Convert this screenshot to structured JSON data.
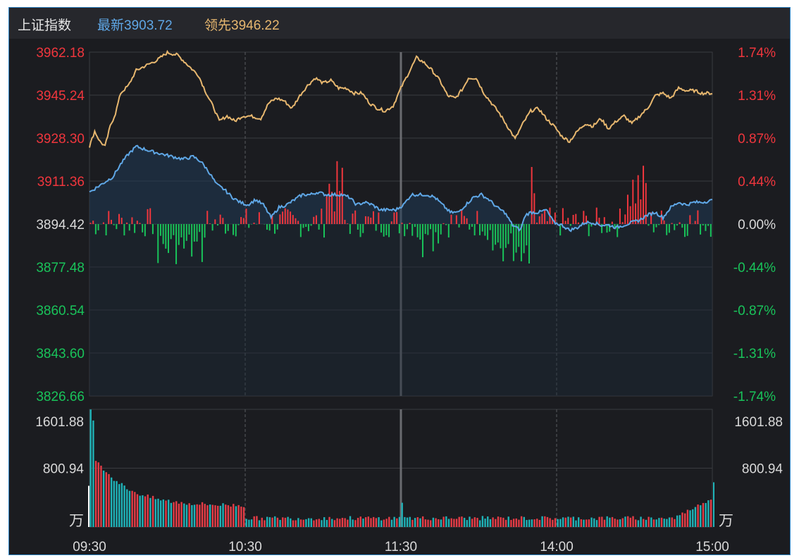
{
  "header": {
    "title": "上证指数",
    "latest_label": "最新3903.72",
    "leading_label": "领先3946.22"
  },
  "colors": {
    "up": "#f0363d",
    "down": "#19c35a",
    "neutral_text": "#d9d9d9",
    "index_line": "#e7b76f",
    "leading_line": "#5fa7e6",
    "volume_up": "#e63c46",
    "volume_down": "#1fb3b8",
    "grid": "#3a3b40"
  },
  "chart_data": {
    "type": "line",
    "title": "上证指数",
    "price_axis": {
      "labels": [
        "3962.18",
        "3945.24",
        "3928.30",
        "3911.36",
        "3894.42",
        "3877.48",
        "3860.54",
        "3843.60",
        "3826.66"
      ],
      "ylim": [
        3826.66,
        3962.18
      ],
      "base": 3894.42
    },
    "percent_axis": {
      "labels": [
        "1.74%",
        "1.31%",
        "0.87%",
        "0.44%",
        "0.00%",
        "-0.44%",
        "-0.87%",
        "-1.31%",
        "-1.74%"
      ]
    },
    "volume_axis": {
      "labels": [
        "1601.88",
        "800.94"
      ],
      "unit": "万",
      "ylim": [
        0,
        1601.88
      ]
    },
    "x_labels": [
      "09:30",
      "10:30",
      "11:30",
      "14:00",
      "15:00"
    ],
    "minutes_total": 240,
    "series": [
      {
        "name": "最新",
        "color": "#e7b76f",
        "points": [
          [
            0,
            3925
          ],
          [
            2,
            3931
          ],
          [
            4,
            3927
          ],
          [
            6,
            3925
          ],
          [
            8,
            3933
          ],
          [
            10,
            3938
          ],
          [
            12,
            3946
          ],
          [
            15,
            3949
          ],
          [
            18,
            3955
          ],
          [
            22,
            3957
          ],
          [
            26,
            3959
          ],
          [
            30,
            3962
          ],
          [
            34,
            3961
          ],
          [
            38,
            3957
          ],
          [
            42,
            3953
          ],
          [
            45,
            3946
          ],
          [
            48,
            3940
          ],
          [
            50,
            3935
          ],
          [
            53,
            3937
          ],
          [
            56,
            3935
          ],
          [
            59,
            3937
          ],
          [
            62,
            3937
          ],
          [
            66,
            3936
          ],
          [
            69,
            3942
          ],
          [
            72,
            3944
          ],
          [
            75,
            3943
          ],
          [
            78,
            3940
          ],
          [
            81,
            3945
          ],
          [
            84,
            3949
          ],
          [
            87,
            3952
          ],
          [
            90,
            3950
          ],
          [
            93,
            3951
          ],
          [
            96,
            3948
          ],
          [
            99,
            3948
          ],
          [
            102,
            3946
          ],
          [
            105,
            3946
          ],
          [
            108,
            3942
          ],
          [
            111,
            3940
          ],
          [
            114,
            3939
          ],
          [
            117,
            3941
          ],
          [
            120,
            3948
          ],
          [
            123,
            3954
          ],
          [
            126,
            3960
          ],
          [
            129,
            3958
          ],
          [
            132,
            3955
          ],
          [
            135,
            3951
          ],
          [
            138,
            3945
          ],
          [
            141,
            3944
          ],
          [
            144,
            3948
          ],
          [
            146,
            3952
          ],
          [
            149,
            3952
          ],
          [
            152,
            3946
          ],
          [
            155,
            3942
          ],
          [
            158,
            3938
          ],
          [
            161,
            3933
          ],
          [
            164,
            3928
          ],
          [
            167,
            3934
          ],
          [
            170,
            3939
          ],
          [
            173,
            3940
          ],
          [
            176,
            3936
          ],
          [
            179,
            3933
          ],
          [
            182,
            3929
          ],
          [
            185,
            3927
          ],
          [
            188,
            3931
          ],
          [
            191,
            3934
          ],
          [
            194,
            3933
          ],
          [
            197,
            3936
          ],
          [
            200,
            3932
          ],
          [
            203,
            3935
          ],
          [
            206,
            3937
          ],
          [
            209,
            3934
          ],
          [
            212,
            3937
          ],
          [
            215,
            3940
          ],
          [
            218,
            3945
          ],
          [
            221,
            3946
          ],
          [
            224,
            3944
          ],
          [
            227,
            3948
          ],
          [
            230,
            3947
          ],
          [
            233,
            3947
          ],
          [
            236,
            3946
          ],
          [
            240,
            3946
          ]
        ]
      },
      {
        "name": "领先",
        "color": "#5fa7e6",
        "points": [
          [
            0,
            3907
          ],
          [
            3,
            3909
          ],
          [
            6,
            3911
          ],
          [
            9,
            3913
          ],
          [
            12,
            3918
          ],
          [
            15,
            3922
          ],
          [
            18,
            3925
          ],
          [
            21,
            3924
          ],
          [
            24,
            3923
          ],
          [
            28,
            3922
          ],
          [
            32,
            3921
          ],
          [
            36,
            3920
          ],
          [
            40,
            3921
          ],
          [
            43,
            3919
          ],
          [
            46,
            3915
          ],
          [
            49,
            3910
          ],
          [
            52,
            3908
          ],
          [
            55,
            3905
          ],
          [
            58,
            3903
          ],
          [
            61,
            3902
          ],
          [
            64,
            3904
          ],
          [
            67,
            3902
          ],
          [
            70,
            3897
          ],
          [
            73,
            3901
          ],
          [
            76,
            3902
          ],
          [
            79,
            3904
          ],
          [
            82,
            3906
          ],
          [
            85,
            3906
          ],
          [
            88,
            3907
          ],
          [
            91,
            3906
          ],
          [
            94,
            3906
          ],
          [
            97,
            3906
          ],
          [
            100,
            3905
          ],
          [
            103,
            3902
          ],
          [
            106,
            3903
          ],
          [
            109,
            3902
          ],
          [
            112,
            3900
          ],
          [
            115,
            3900
          ],
          [
            118,
            3900
          ],
          [
            121,
            3902
          ],
          [
            124,
            3906
          ],
          [
            127,
            3906
          ],
          [
            130,
            3906
          ],
          [
            133,
            3905
          ],
          [
            136,
            3902
          ],
          [
            139,
            3899
          ],
          [
            142,
            3899
          ],
          [
            145,
            3902
          ],
          [
            148,
            3905
          ],
          [
            151,
            3906
          ],
          [
            154,
            3904
          ],
          [
            157,
            3901
          ],
          [
            160,
            3899
          ],
          [
            163,
            3894
          ],
          [
            166,
            3892
          ],
          [
            168,
            3898
          ],
          [
            170,
            3899
          ],
          [
            173,
            3899
          ],
          [
            176,
            3900
          ],
          [
            179,
            3895
          ],
          [
            182,
            3894
          ],
          [
            185,
            3892
          ],
          [
            188,
            3893
          ],
          [
            191,
            3895
          ],
          [
            194,
            3895
          ],
          [
            197,
            3894
          ],
          [
            200,
            3894
          ],
          [
            203,
            3893
          ],
          [
            206,
            3894
          ],
          [
            209,
            3895
          ],
          [
            212,
            3896
          ],
          [
            215,
            3898
          ],
          [
            218,
            3899
          ],
          [
            221,
            3897
          ],
          [
            224,
            3901
          ],
          [
            227,
            3903
          ],
          [
            230,
            3902
          ],
          [
            233,
            3903
          ],
          [
            236,
            3903
          ],
          [
            240,
            3903.72
          ]
        ]
      }
    ],
    "bars_note": "red/green diff bars around base 3894.42 and volume bars at bottom"
  }
}
